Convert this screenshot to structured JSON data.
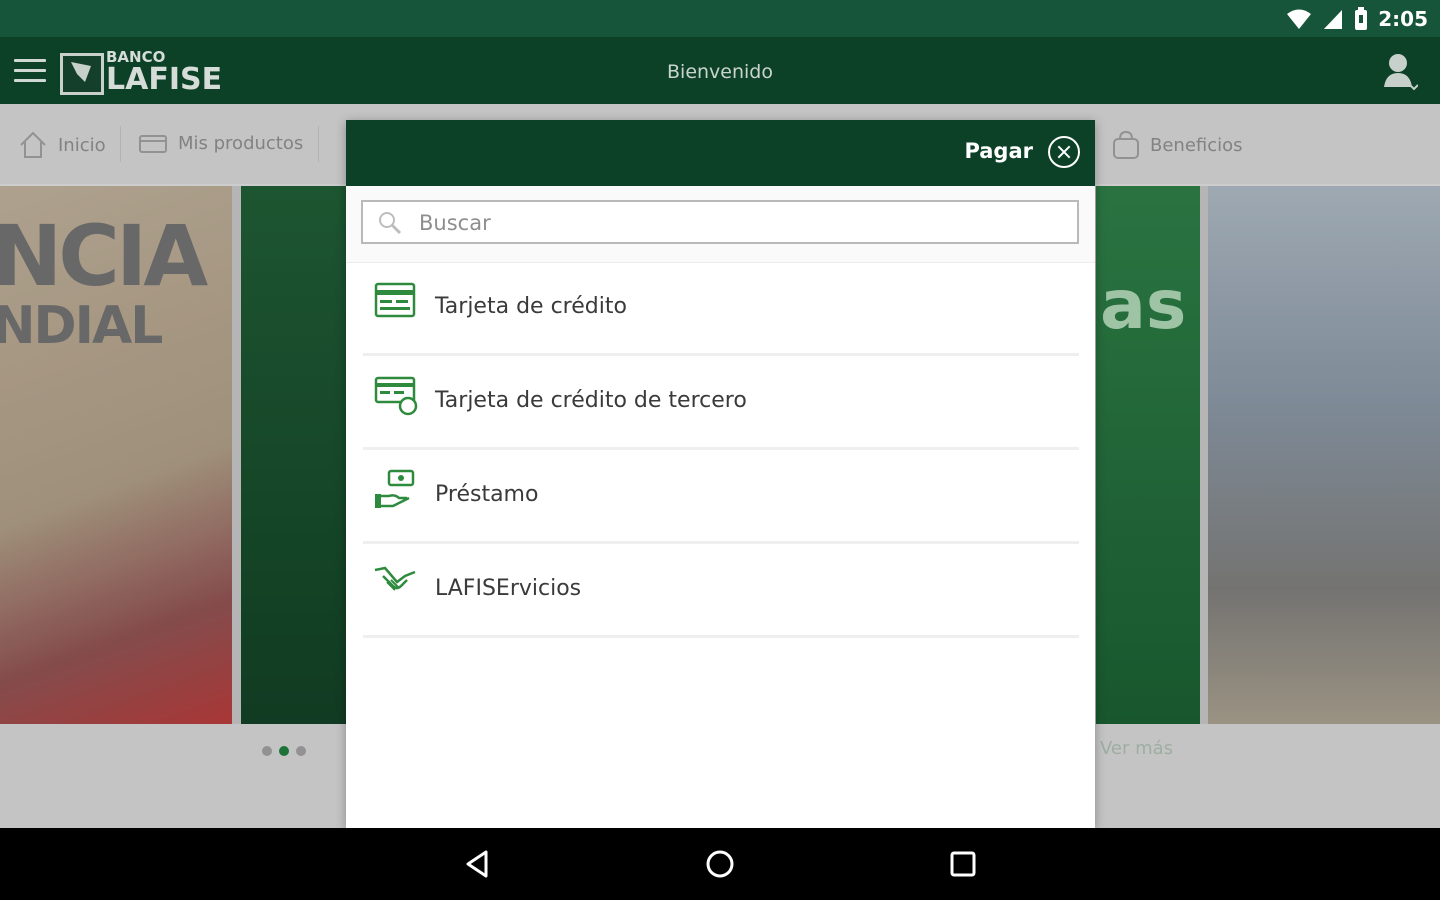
{
  "status_bar": {
    "time": "2:05"
  },
  "app_bar": {
    "logo_top": "BANCO",
    "logo_main": "LAFISE",
    "title": "Bienvenido"
  },
  "nav_tabs": [
    {
      "label": "Inicio",
      "icon": "home-icon"
    },
    {
      "label": "Mis productos",
      "icon": "wallet-icon"
    },
    {
      "label": "Beneficios",
      "icon": "bag-icon"
    }
  ],
  "carousel": {
    "slide1_line1": "NCIA",
    "slide1_line2": "NDIAL",
    "slide3_text": "as",
    "see_more": "Ver más"
  },
  "dialog": {
    "title": "Pagar",
    "search_placeholder": "Buscar",
    "items": [
      {
        "label": "Tarjeta de crédito",
        "icon": "credit-card-icon"
      },
      {
        "label": "Tarjeta de crédito de tercero",
        "icon": "third-party-card-icon"
      },
      {
        "label": "Préstamo",
        "icon": "loan-icon"
      },
      {
        "label": "LAFISErvicios",
        "icon": "services-handshake-icon"
      }
    ]
  },
  "colors": {
    "primary_dark": "#0c4127",
    "status_bar": "#17553a",
    "accent_green": "#2e8b3e"
  }
}
